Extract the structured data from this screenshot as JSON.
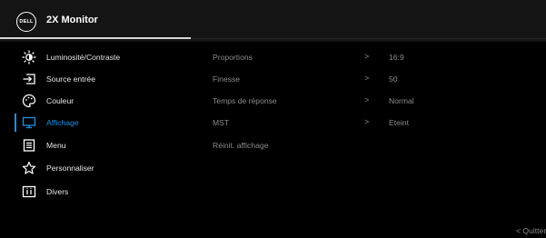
{
  "header": {
    "logo_text": "DELL",
    "title": "2X Monitor"
  },
  "menu": {
    "items": [
      {
        "label": "Luminosité/Contraste",
        "icon": "brightness-icon",
        "active": false
      },
      {
        "label": "Source entrée",
        "icon": "input-source-icon",
        "active": false
      },
      {
        "label": "Couleur",
        "icon": "color-palette-icon",
        "active": false
      },
      {
        "label": "Affichage",
        "icon": "display-monitor-icon",
        "active": true
      },
      {
        "label": "Menu",
        "icon": "menu-list-icon",
        "active": false
      },
      {
        "label": "Personnaliser",
        "icon": "star-icon",
        "active": false
      },
      {
        "label": "Divers",
        "icon": "info-icon",
        "active": false
      }
    ]
  },
  "settings": {
    "rows": [
      {
        "name": "Proportions",
        "chevron": ">",
        "value": "16:9"
      },
      {
        "name": "Finesse",
        "chevron": ">",
        "value": "50"
      },
      {
        "name": "Temps de réponse",
        "chevron": ">",
        "value": "Normal"
      },
      {
        "name": "MST",
        "chevron": ">",
        "value": "Eteint"
      },
      {
        "name": "Réinit. affichage",
        "chevron": "",
        "value": ""
      }
    ]
  },
  "footer": {
    "quit_label": "< Quitter"
  },
  "colors": {
    "accent": "#1e8fe5",
    "background": "#000000",
    "header_bg": "#141414",
    "inactive_text": "#8a8a8a"
  }
}
